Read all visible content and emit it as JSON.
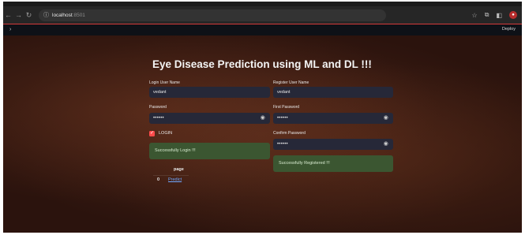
{
  "browser": {
    "url_host": "localhost",
    "url_port": ":8501"
  },
  "app": {
    "deploy_label": "Deploy",
    "title": "Eye Disease Prediction using ML and DL !!!"
  },
  "login": {
    "username_label": "Login User Name",
    "username_value": "vedant",
    "password_label": "Password",
    "password_value": "••••••",
    "checkbox_label": "LOGIN",
    "checkbox_checked": true,
    "success_message": "Successfully Login !!!",
    "table": {
      "header": "page",
      "rows": [
        {
          "index": "0",
          "link": "Predict"
        }
      ]
    }
  },
  "register": {
    "username_label": "Register User Name",
    "username_value": "vedant",
    "first_password_label": "First Password",
    "first_password_value": "••••••",
    "confirm_password_label": "Confirm Password",
    "confirm_password_value": "••••••",
    "success_message": "Successfully Registered !!!"
  },
  "colors": {
    "accent": "#ff4b4b",
    "success_bg": "#3b5631",
    "input_bg": "#262838",
    "link": "#6fa8ff"
  }
}
